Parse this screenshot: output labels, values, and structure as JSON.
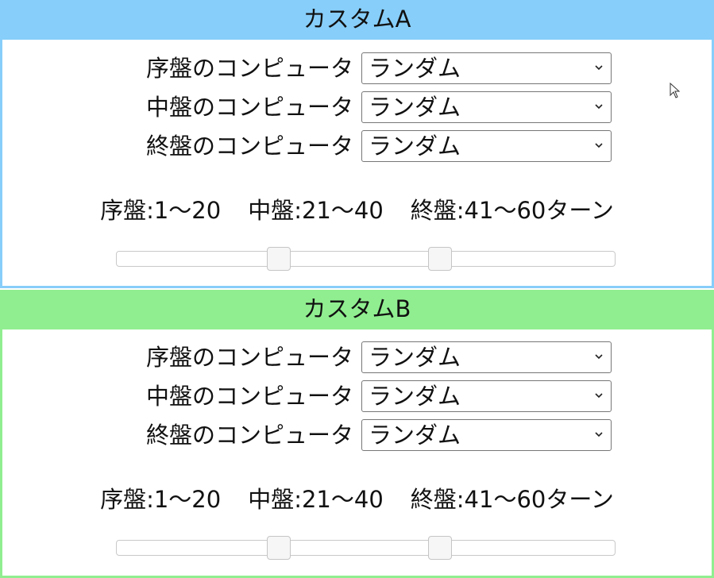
{
  "panels": [
    {
      "title": "カスタムA",
      "accent": "#87cefa",
      "rows": [
        {
          "label": "序盤のコンピュータ",
          "value": "ランダム"
        },
        {
          "label": "中盤のコンピュータ",
          "value": "ランダム"
        },
        {
          "label": "終盤のコンピュータ",
          "value": "ランダム"
        }
      ],
      "ranges": {
        "early": "序盤:1～20",
        "mid": "中盤:21～40",
        "late": "終盤:41～60ターン"
      },
      "slider": {
        "min": 1,
        "max": 60,
        "handles": [
          20,
          40
        ]
      }
    },
    {
      "title": "カスタムB",
      "accent": "#90ee90",
      "rows": [
        {
          "label": "序盤のコンピュータ",
          "value": "ランダム"
        },
        {
          "label": "中盤のコンピュータ",
          "value": "ランダム"
        },
        {
          "label": "終盤のコンピュータ",
          "value": "ランダム"
        }
      ],
      "ranges": {
        "early": "序盤:1～20",
        "mid": "中盤:21～40",
        "late": "終盤:41～60ターン"
      },
      "slider": {
        "min": 1,
        "max": 60,
        "handles": [
          20,
          40
        ]
      }
    }
  ],
  "icons": {
    "dropdown": "chevron-down-icon",
    "cursor": "mouse-pointer-icon"
  }
}
